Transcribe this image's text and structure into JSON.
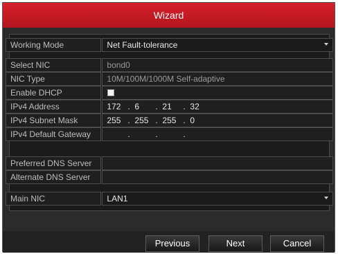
{
  "window": {
    "title": "Wizard"
  },
  "form": {
    "working_mode": {
      "label": "Working Mode",
      "value": "Net Fault-tolerance"
    },
    "select_nic": {
      "label": "Select NIC",
      "value": "bond0"
    },
    "nic_type": {
      "label": "NIC Type",
      "value": "10M/100M/1000M Self-adaptive"
    },
    "enable_dhcp": {
      "label": "Enable DHCP",
      "checked": false
    },
    "ipv4_address": {
      "label": "IPv4 Address",
      "octets": [
        "172",
        "6",
        "21",
        "32"
      ]
    },
    "ipv4_subnet_mask": {
      "label": "IPv4 Subnet Mask",
      "octets": [
        "255",
        "255",
        "255",
        "0"
      ]
    },
    "ipv4_default_gateway": {
      "label": "IPv4 Default Gateway",
      "octets": [
        "",
        "",
        "",
        ""
      ]
    },
    "preferred_dns": {
      "label": "Preferred DNS Server",
      "value": ""
    },
    "alternate_dns": {
      "label": "Alternate DNS Server",
      "value": ""
    },
    "main_nic": {
      "label": "Main NIC",
      "value": "LAN1"
    }
  },
  "buttons": {
    "previous": "Previous",
    "next": "Next",
    "cancel": "Cancel"
  },
  "colors": {
    "title_bar": "#c81b25",
    "panel_bg": "#2b2b2b",
    "field_bg": "#1f1f1f"
  }
}
